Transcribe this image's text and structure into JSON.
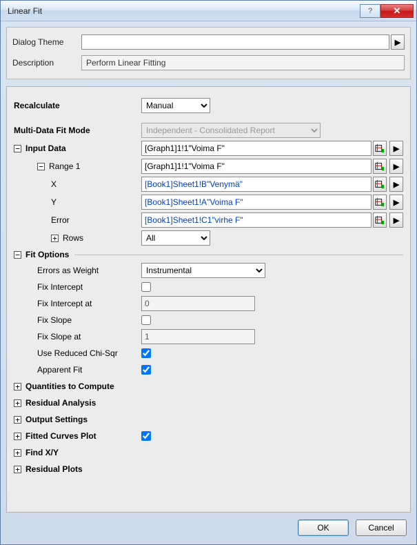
{
  "window": {
    "title": "Linear Fit"
  },
  "top": {
    "theme_label": "Dialog Theme",
    "theme_value": "",
    "desc_label": "Description",
    "desc_value": "Perform Linear Fitting"
  },
  "form": {
    "recalculate": {
      "label": "Recalculate",
      "value": "Manual"
    },
    "multi_mode": {
      "label": "Multi-Data Fit Mode",
      "value": "Independent - Consolidated Report"
    },
    "input_data": {
      "label": "Input Data",
      "value": "[Graph1]1!1\"Voima F\""
    },
    "range1": {
      "label": "Range 1",
      "value": "[Graph1]1!1\"Voima F\""
    },
    "x": {
      "label": "X",
      "value": "[Book1]Sheet1!B\"Venymä\""
    },
    "y": {
      "label": "Y",
      "value": "[Book1]Sheet1!A\"Voima F\""
    },
    "err": {
      "label": "Error",
      "value": "[Book1]Sheet1!C1\"virhe F\""
    },
    "rows": {
      "label": "Rows",
      "value": "All"
    },
    "fit_options": {
      "label": "Fit Options"
    },
    "errors_as_weight": {
      "label": "Errors as Weight",
      "value": "Instrumental"
    },
    "fix_intercept": {
      "label": "Fix Intercept"
    },
    "fix_intercept_at": {
      "label": "Fix Intercept at",
      "value": "0"
    },
    "fix_slope": {
      "label": "Fix Slope"
    },
    "fix_slope_at": {
      "label": "Fix Slope at",
      "value": "1"
    },
    "use_reduced": {
      "label": "Use Reduced Chi-Sqr"
    },
    "apparent_fit": {
      "label": "Apparent Fit"
    },
    "quantities": {
      "label": "Quantities to Compute"
    },
    "residual_analysis": {
      "label": "Residual Analysis"
    },
    "output_settings": {
      "label": "Output Settings"
    },
    "fitted_curves": {
      "label": "Fitted Curves Plot"
    },
    "find_xy": {
      "label": "Find X/Y"
    },
    "residual_plots": {
      "label": "Residual Plots"
    }
  },
  "footer": {
    "ok": "OK",
    "cancel": "Cancel"
  },
  "glyphs": {
    "minus": "−",
    "plus": "+"
  }
}
